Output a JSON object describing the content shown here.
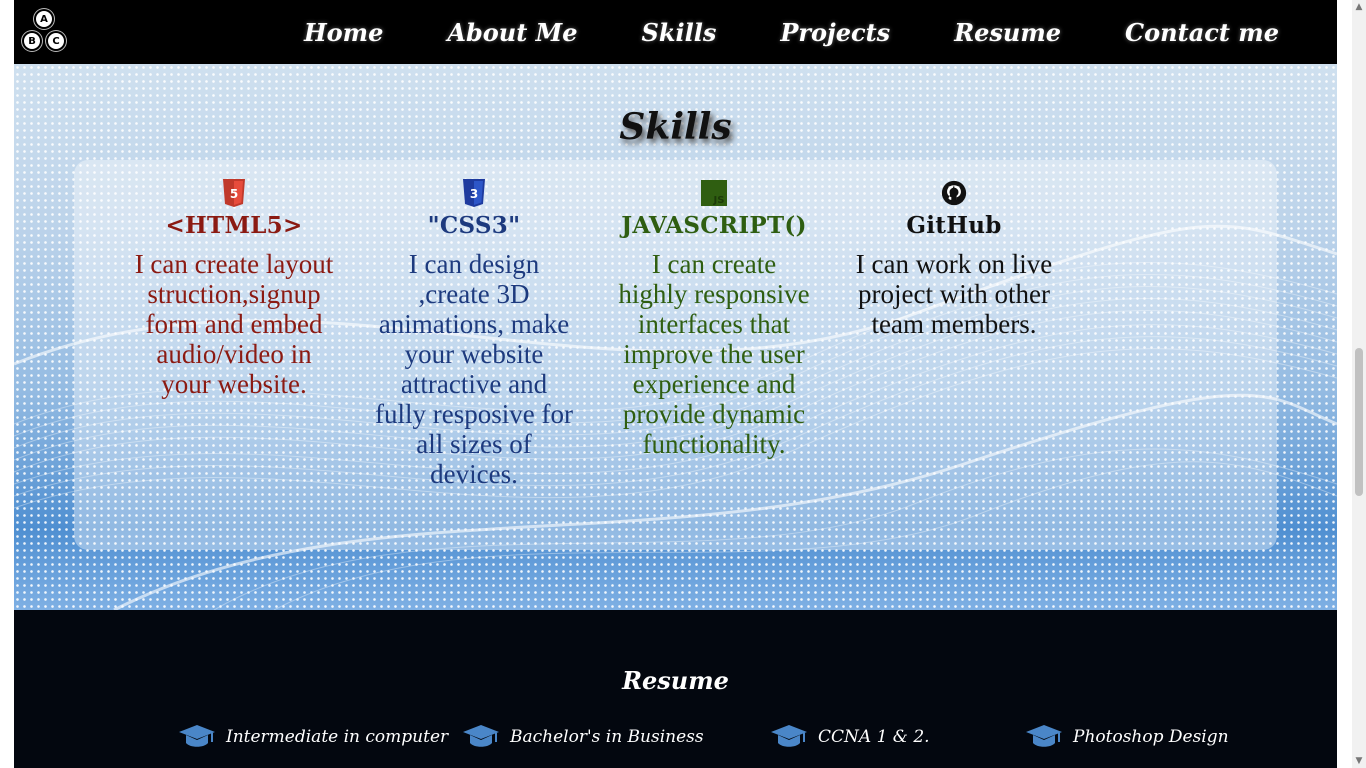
{
  "logo": {
    "letters": [
      "A",
      "B",
      "C"
    ]
  },
  "nav": {
    "items": [
      "Home",
      "About Me",
      "Skills",
      "Projects",
      "Resume",
      "Contact me"
    ]
  },
  "skills": {
    "title": "Skills",
    "items": [
      {
        "icon": "html5-icon",
        "icon_text": "5",
        "name": "<HTML5>",
        "color": "#8b1a12",
        "description": "I can create layout struction,signup form and embed audio/video in your website."
      },
      {
        "icon": "css3-icon",
        "icon_text": "3",
        "name": "\"CSS3\"",
        "color": "#1d3a7e",
        "description": "I can design ,create 3D animations, make your website attractive and fully resposive for all sizes of devices."
      },
      {
        "icon": "javascript-icon",
        "icon_text": "JS",
        "name": "JAVASCRIPT()",
        "color": "#2f5e11",
        "description": "I can create highly responsive interfaces that improve the user experience and provide dynamic functionality."
      },
      {
        "icon": "github-icon",
        "icon_text": "",
        "name": "GitHub",
        "color": "#111111",
        "description": "I can work on live project with other team members."
      }
    ]
  },
  "resume": {
    "title": "Resume",
    "items": [
      {
        "icon": "graduation-cap-icon",
        "label": "Intermediate in computer"
      },
      {
        "icon": "graduation-cap-icon",
        "label": "Bachelor's in Business"
      },
      {
        "icon": "graduation-cap-icon",
        "label": "CCNA 1 & 2."
      },
      {
        "icon": "graduation-cap-icon",
        "label": "Photoshop Design"
      }
    ]
  },
  "colors": {
    "nav_bg": "#000000",
    "resume_bg": "#03070f",
    "cap_blue": "#4a86c8"
  }
}
